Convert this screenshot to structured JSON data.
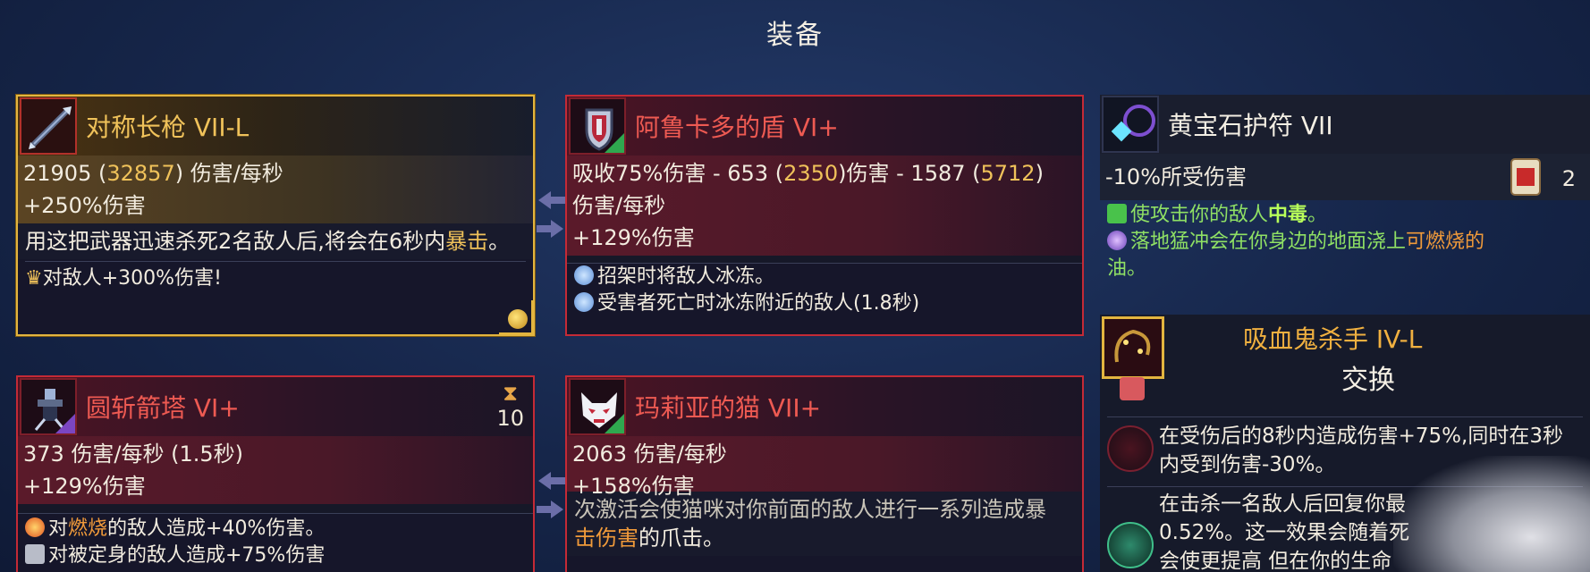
{
  "screen": {
    "title": "装备"
  },
  "items": {
    "lance": {
      "name": "对称长枪 VII-L",
      "dps": "21905",
      "dps_alt": "32857",
      "dps_unit": "伤害/每秒",
      "dmg_bonus": "+250%伤害",
      "desc_a": "用这把武器迅速杀死2名敌人后,将会在6秒内",
      "desc_hl": "暴击",
      "desc_b": "。",
      "bonus_prefix": "对敌人+300%伤害!"
    },
    "shield": {
      "name": "阿鲁卡多的盾 VI+",
      "line1_a": "吸收75%伤害 - 653 (",
      "line1_v1": "2350",
      "line1_b": ")伤害 - 1587 (",
      "line1_v2": "5712",
      "line1_c": ")",
      "line2": "伤害/每秒",
      "dmg_bonus": "+129%伤害",
      "effect1": "招架时将敌人冰冻。",
      "effect2": "受害者死亡时冰冻附近的敌人(1.8秒)"
    },
    "amulet": {
      "name": "黄宝石护符 VII",
      "stat": "-10%所受伤害",
      "scroll_count": "2",
      "effect1_a": "使攻击你的敌人",
      "effect1_hl": "中毒",
      "effect1_b": "。",
      "effect2_a": "落地猛冲会在你身边的地面浇上",
      "effect2_hl": "可燃烧的",
      "effect2_b": "油。"
    },
    "turret": {
      "name": "圆斩箭塔 VI+",
      "cooldown": "10",
      "dps_line": "373 伤害/每秒 (1.5秒)",
      "dmg_bonus": "+129%伤害",
      "effect1_a": "对",
      "effect1_hl": "燃烧",
      "effect1_b": "的敌人造成+40%伤害。",
      "effect2": "对被定身的敌人造成+75%伤害"
    },
    "cat": {
      "name": "玛莉亚的猫 VII+",
      "dps_line": "2063 伤害/每秒",
      "dmg_bonus": "+158%伤害",
      "desc_cut": "次激活会使猫咪对你前面的敌人进行一系列造成暴",
      "desc_hl": "击伤害",
      "desc_b": "的爪击。"
    },
    "vampire": {
      "title": "吸血鬼杀手 IV-L",
      "action": "交换",
      "mut1": "在受伤后的8秒内造成伤害+75%,同时在3秒内受到伤害-30%。",
      "mut2_a": "在击杀一名敌人后回复你最",
      "mut2_b": "0.52%。这一效果会随着死",
      "mut2_c": "会使更提高 但在你的生命"
    }
  }
}
